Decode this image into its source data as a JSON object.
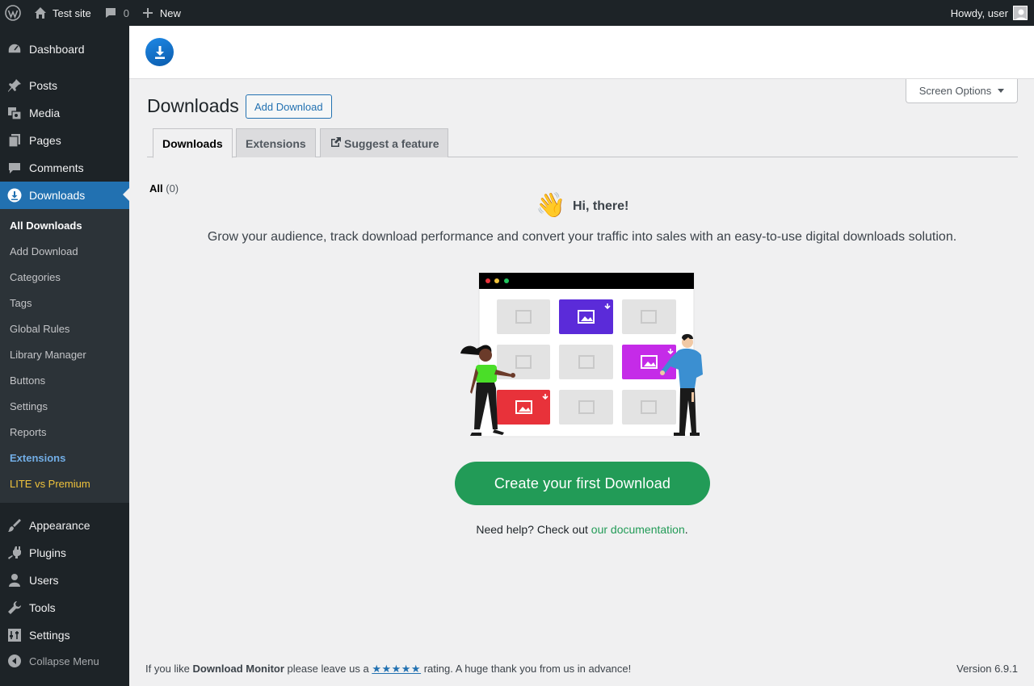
{
  "adminbar": {
    "site_name": "Test site",
    "comments_count": "0",
    "new_label": "New",
    "howdy": "Howdy, user"
  },
  "sidebar": {
    "items": [
      {
        "label": "Dashboard",
        "icon": "dashboard-icon"
      },
      {
        "label": "Posts",
        "icon": "pin-icon"
      },
      {
        "label": "Media",
        "icon": "media-icon"
      },
      {
        "label": "Pages",
        "icon": "pages-icon"
      },
      {
        "label": "Comments",
        "icon": "comment-icon"
      },
      {
        "label": "Downloads",
        "icon": "download-icon"
      },
      {
        "label": "Appearance",
        "icon": "brush-icon"
      },
      {
        "label": "Plugins",
        "icon": "plugin-icon"
      },
      {
        "label": "Users",
        "icon": "user-icon"
      },
      {
        "label": "Tools",
        "icon": "wrench-icon"
      },
      {
        "label": "Settings",
        "icon": "sliders-icon"
      },
      {
        "label": "Collapse Menu",
        "icon": "collapse-icon"
      }
    ],
    "submenu": [
      "All Downloads",
      "Add Download",
      "Categories",
      "Tags",
      "Global Rules",
      "Library Manager",
      "Buttons",
      "Settings",
      "Reports",
      "Extensions",
      "LITE vs Premium"
    ]
  },
  "screen_options": "Screen Options",
  "page": {
    "title": "Downloads",
    "add_button": "Add Download",
    "tabs": [
      "Downloads",
      "Extensions",
      "Suggest a feature"
    ],
    "filter_all": "All",
    "filter_count": "(0)"
  },
  "empty_state": {
    "emoji": "👋",
    "greeting": "Hi, there!",
    "tagline": "Grow your audience, track download performance and convert your traffic into sales with an easy-to-use digital downloads solution.",
    "cta": "Create your first Download",
    "help_prefix": "Need help? Check out ",
    "help_link": "our documentation",
    "help_suffix": "."
  },
  "footer": {
    "prefix": "If you like ",
    "plugin": "Download Monitor",
    "middle": " please leave us a ",
    "stars": "★★★★★",
    "suffix": " rating. A huge thank you from us in advance!",
    "version": "Version 6.9.1"
  },
  "colors": {
    "admin_dark": "#1d2327",
    "admin_blue": "#2271b1",
    "cta_green": "#229b57",
    "tile_purple": "#5b2bd9",
    "tile_magenta": "#c52be8",
    "tile_red": "#e8323a"
  }
}
